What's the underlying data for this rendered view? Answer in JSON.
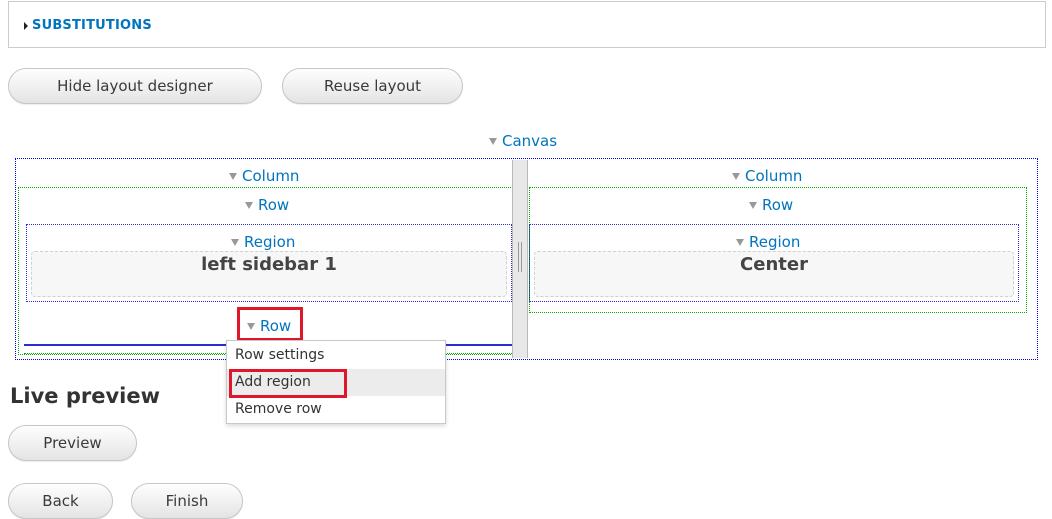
{
  "substitutions": {
    "label": "SUBSTITUTIONS"
  },
  "buttons": {
    "hide_layout_designer": "Hide layout designer",
    "reuse_layout": "Reuse layout",
    "preview": "Preview",
    "back": "Back",
    "finish": "Finish"
  },
  "layout": {
    "canvas": "Canvas",
    "left_column": {
      "column": "Column",
      "row": "Row",
      "region": "Region",
      "region_name": "left sidebar 1",
      "second_row": "Row"
    },
    "right_column": {
      "column": "Column",
      "row": "Row",
      "region": "Region",
      "region_name": "Center"
    }
  },
  "row_menu": {
    "items": [
      "Row settings",
      "Add region",
      "Remove row"
    ],
    "highlighted": "Add region"
  },
  "live_preview": {
    "heading": "Live preview"
  },
  "colors": {
    "link": "#0074bd",
    "highlight": "#e0162b",
    "canvas_border": "#0000ff",
    "row_border": "#00aa00"
  }
}
